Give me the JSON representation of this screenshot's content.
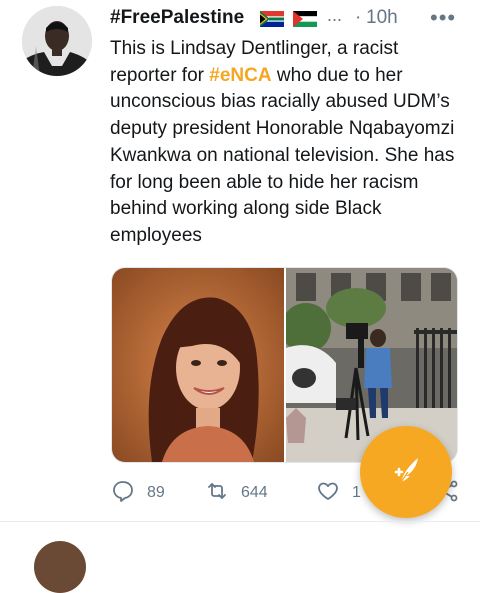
{
  "tweet": {
    "display_name": "#FreePalestine",
    "name_overflow": "...",
    "separator": "·",
    "time": "10h",
    "more_label": "•••",
    "text_prefix": "This is Lindsay Dentlinger, a racist reporter for ",
    "hashtag": "#eNCA",
    "text_suffix": " who due to her unconscious bias racially abused UDM’s deputy president Honorable Nqabayomzi Kwankwa on national television. She has for long been able to hide her racism behind working along side Black employees",
    "media_count": 2
  },
  "actions": {
    "reply_count": "89",
    "retweet_count": "644",
    "like_count": "1"
  },
  "icons": {
    "avatar": "avatar",
    "flag_1": "south-africa-flag-icon",
    "flag_2": "palestine-flag-icon",
    "more": "more-icon",
    "reply": "reply-icon",
    "retweet": "retweet-icon",
    "like": "heart-icon",
    "share": "share-icon",
    "compose": "compose-tweet-icon"
  },
  "colors": {
    "accent": "#f7a823",
    "hashtag": "#f5a623",
    "secondary_text": "#657786"
  }
}
